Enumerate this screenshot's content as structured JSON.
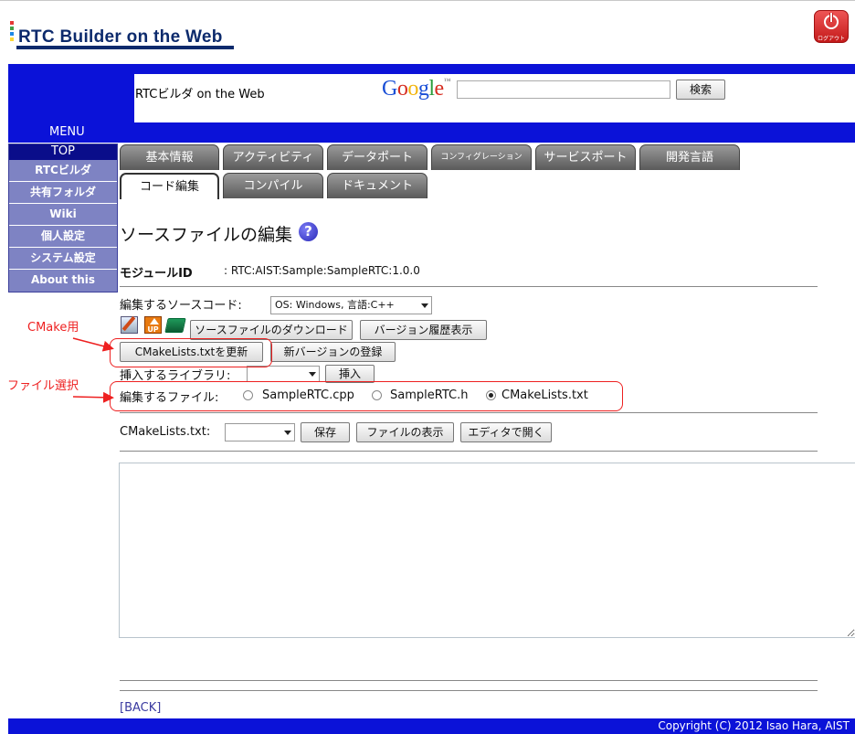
{
  "brand": {
    "logo_main": "RTC Builder on the Web",
    "logo_colors": [
      "#e53935",
      "#43a047",
      "#1e88e5",
      "#fdd835"
    ],
    "logout_label": "ログアウト"
  },
  "header": {
    "site_name": "RTCビルダ on the Web",
    "google_logo": [
      "G",
      "o",
      "o",
      "g",
      "l",
      "e"
    ],
    "google_colors": [
      "#1a4fd6",
      "#d62d20",
      "#f2b50f",
      "#1a4fd6",
      "#2a9c3b",
      "#d62d20"
    ],
    "google_tm": "™",
    "search_placeholder": "",
    "search_button": "検索"
  },
  "menu": {
    "title": "MENU",
    "items": [
      "TOP",
      "RTCビルダ",
      "共有フォルダ",
      "Wiki",
      "個人設定",
      "システム設定",
      "About this"
    ]
  },
  "tabs": {
    "row1": [
      "基本情報",
      "アクティビティ",
      "データポート",
      "コンフィグレーション",
      "サービスポート",
      "開発言語"
    ],
    "row2": [
      "コード編集",
      "コンパイル",
      "ドキュメント"
    ],
    "active": "コード編集"
  },
  "page": {
    "title": "ソースファイルの編集",
    "help_icon": "?",
    "module_id_label": "モジュールID",
    "module_id_value": ": RTC:AIST:Sample:SampleRTC:1.0.0"
  },
  "form": {
    "source_code_label": "編集するソースコード:",
    "source_code_value": "OS: Windows, 言語:C++",
    "download_button": "ソースファイルのダウンロード",
    "history_button": "バージョン履歴表示",
    "cmake_update_button": "CMakeLists.txtを更新",
    "new_version_button": "新バージョンの登録",
    "library_label": "挿入するライブラリ:",
    "library_value": "",
    "insert_button": "挿入",
    "file_label": "編集するファイル:",
    "files": [
      "SampleRTC.cpp",
      "SampleRTC.h",
      "CMakeLists.txt"
    ],
    "selected_file": "CMakeLists.txt",
    "current_file_label": "CMakeLists.txt:",
    "current_file_value": "",
    "save_button": "保存",
    "show_file_button": "ファイルの表示",
    "open_editor_button": "エディタで開く",
    "editor_content": ""
  },
  "annotations": {
    "cmake": "CMake用",
    "file_select": "ファイル選択",
    "color": "#ee2020"
  },
  "footer": {
    "back_link": "[BACK]",
    "copyright": "Copyright (C) 2012 Isao Hara, AIST"
  }
}
